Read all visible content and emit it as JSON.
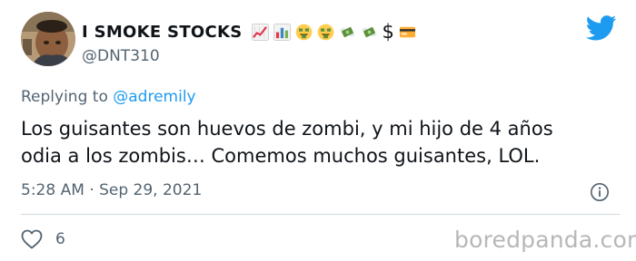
{
  "author": {
    "display_name": "I SMOKE STOCKS",
    "handle": "@DNT310",
    "name_emojis": [
      "chart-increasing",
      "bar-chart",
      "money-mouth-face",
      "money-mouth-face",
      "money-with-wings",
      "money-with-wings",
      "heavy-dollar-sign",
      "credit-card"
    ],
    "dollar_glyph": "$"
  },
  "reply": {
    "prefix": "Replying to ",
    "mention": "@adremily"
  },
  "tweet": {
    "lines": [
      "Los guisantes son huevos de zombi, y mi hijo de 4 años",
      "odia a los zombis… Comemos muchos guisantes, LOL."
    ],
    "time": "5:28 AM",
    "separator": "·",
    "date": "Sep 29, 2021"
  },
  "engagement": {
    "likes": "6"
  },
  "watermark": "boredpanda.com",
  "colors": {
    "twitter_blue": "#1d9bf0",
    "text": "#0f1419",
    "secondary_text": "#536471",
    "divider": "#cfd9de",
    "watermark": "#b7b7b7"
  }
}
